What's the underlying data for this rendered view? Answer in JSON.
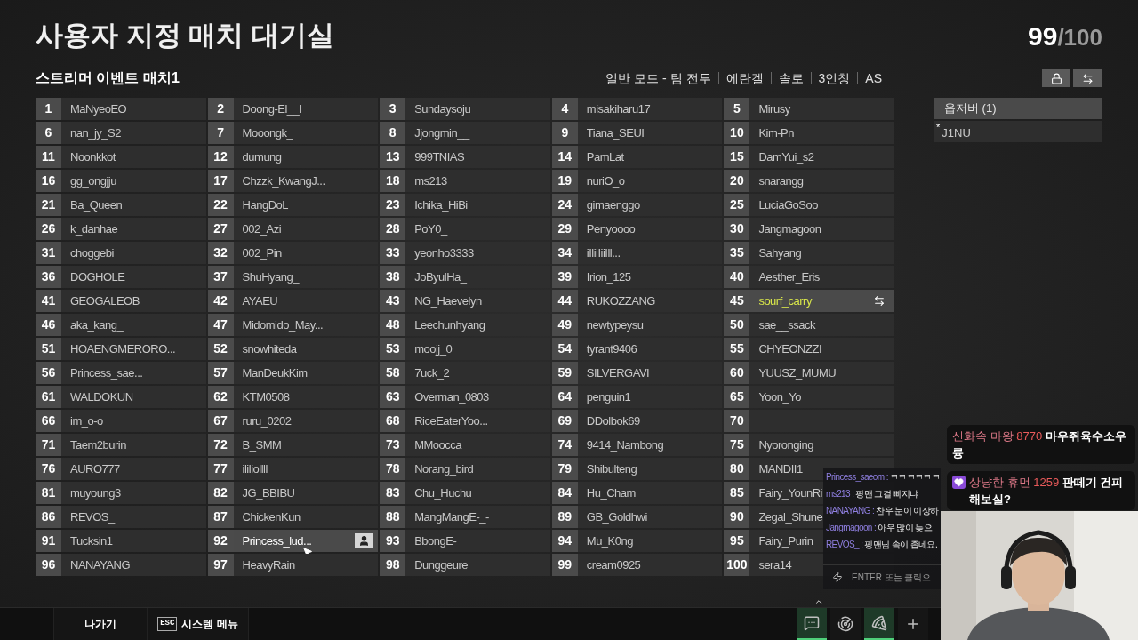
{
  "header": {
    "title": "사용자 지정 매치 대기실",
    "count": "99",
    "capacity": "/100"
  },
  "match": {
    "name": "스트리머 이벤트 매치1",
    "tags": [
      "일반 모드 - 팀 전투",
      "에란겔",
      "솔로",
      "3인칭",
      "AS"
    ]
  },
  "slots": [
    {
      "number": "1",
      "name": "MaNyeoEO",
      "selected": false,
      "hovered": false
    },
    {
      "number": "2",
      "name": "Doong-El__l",
      "selected": false,
      "hovered": false
    },
    {
      "number": "3",
      "name": "Sundaysoju",
      "selected": false,
      "hovered": false
    },
    {
      "number": "4",
      "name": "misakiharu17",
      "selected": false,
      "hovered": false
    },
    {
      "number": "5",
      "name": "Mirusy",
      "selected": false,
      "hovered": false
    },
    {
      "number": "6",
      "name": "nan_jy_S2",
      "selected": false,
      "hovered": false
    },
    {
      "number": "7",
      "name": "Mooongk_",
      "selected": false,
      "hovered": false
    },
    {
      "number": "8",
      "name": "Jjongmin__",
      "selected": false,
      "hovered": false
    },
    {
      "number": "9",
      "name": "Tiana_SEUI",
      "selected": false,
      "hovered": false
    },
    {
      "number": "10",
      "name": "Kim-Pn",
      "selected": false,
      "hovered": false
    },
    {
      "number": "11",
      "name": "Noonkkot",
      "selected": false,
      "hovered": false
    },
    {
      "number": "12",
      "name": "dumung",
      "selected": false,
      "hovered": false
    },
    {
      "number": "13",
      "name": "999TNIAS",
      "selected": false,
      "hovered": false
    },
    {
      "number": "14",
      "name": "PamLat",
      "selected": false,
      "hovered": false
    },
    {
      "number": "15",
      "name": "DamYui_s2",
      "selected": false,
      "hovered": false
    },
    {
      "number": "16",
      "name": "gg_ongjju",
      "selected": false,
      "hovered": false
    },
    {
      "number": "17",
      "name": "Chzzk_KwangJ...",
      "selected": false,
      "hovered": false
    },
    {
      "number": "18",
      "name": "ms213",
      "selected": false,
      "hovered": false
    },
    {
      "number": "19",
      "name": "nuriO_o",
      "selected": false,
      "hovered": false
    },
    {
      "number": "20",
      "name": "snarangg",
      "selected": false,
      "hovered": false
    },
    {
      "number": "21",
      "name": "Ba_Queen",
      "selected": false,
      "hovered": false
    },
    {
      "number": "22",
      "name": "HangDoL",
      "selected": false,
      "hovered": false
    },
    {
      "number": "23",
      "name": "Ichika_HiBi",
      "selected": false,
      "hovered": false
    },
    {
      "number": "24",
      "name": "gimaenggo",
      "selected": false,
      "hovered": false
    },
    {
      "number": "25",
      "name": "LuciaGoSoo",
      "selected": false,
      "hovered": false
    },
    {
      "number": "26",
      "name": "k_danhae",
      "selected": false,
      "hovered": false
    },
    {
      "number": "27",
      "name": "002_Azi",
      "selected": false,
      "hovered": false
    },
    {
      "number": "28",
      "name": "PoY0_",
      "selected": false,
      "hovered": false
    },
    {
      "number": "29",
      "name": "Penyoooo",
      "selected": false,
      "hovered": false
    },
    {
      "number": "30",
      "name": "Jangmagoon",
      "selected": false,
      "hovered": false
    },
    {
      "number": "31",
      "name": "choggebi",
      "selected": false,
      "hovered": false
    },
    {
      "number": "32",
      "name": "002_Pin",
      "selected": false,
      "hovered": false
    },
    {
      "number": "33",
      "name": "yeonho3333",
      "selected": false,
      "hovered": false
    },
    {
      "number": "34",
      "name": "iIliiIiiIll...",
      "selected": false,
      "hovered": false
    },
    {
      "number": "35",
      "name": "Sahyang",
      "selected": false,
      "hovered": false
    },
    {
      "number": "36",
      "name": "DOGHOLE",
      "selected": false,
      "hovered": false
    },
    {
      "number": "37",
      "name": "ShuHyang_",
      "selected": false,
      "hovered": false
    },
    {
      "number": "38",
      "name": "JoByulHa_",
      "selected": false,
      "hovered": false
    },
    {
      "number": "39",
      "name": "Irion_125",
      "selected": false,
      "hovered": false
    },
    {
      "number": "40",
      "name": "Aesther_Eris",
      "selected": false,
      "hovered": false
    },
    {
      "number": "41",
      "name": "GEOGALEOB",
      "selected": false,
      "hovered": false
    },
    {
      "number": "42",
      "name": "AYAEU",
      "selected": false,
      "hovered": false
    },
    {
      "number": "43",
      "name": "NG_Haevelyn",
      "selected": false,
      "hovered": false
    },
    {
      "number": "44",
      "name": "RUKOZZANG",
      "selected": false,
      "hovered": false
    },
    {
      "number": "45",
      "name": "sourf_carry",
      "selected": true,
      "hovered": false
    },
    {
      "number": "46",
      "name": "aka_kang_",
      "selected": false,
      "hovered": false
    },
    {
      "number": "47",
      "name": "Midomido_May...",
      "selected": false,
      "hovered": false
    },
    {
      "number": "48",
      "name": "Leechunhyang",
      "selected": false,
      "hovered": false
    },
    {
      "number": "49",
      "name": "newtypeysu",
      "selected": false,
      "hovered": false
    },
    {
      "number": "50",
      "name": "sae__ssack",
      "selected": false,
      "hovered": false
    },
    {
      "number": "51",
      "name": "HOAENGMERORO...",
      "selected": false,
      "hovered": false
    },
    {
      "number": "52",
      "name": "snowhiteda",
      "selected": false,
      "hovered": false
    },
    {
      "number": "53",
      "name": "moojj_0",
      "selected": false,
      "hovered": false
    },
    {
      "number": "54",
      "name": "tyrant9406",
      "selected": false,
      "hovered": false
    },
    {
      "number": "55",
      "name": "CHYEONZZI",
      "selected": false,
      "hovered": false
    },
    {
      "number": "56",
      "name": "Princess_sae...",
      "selected": false,
      "hovered": false
    },
    {
      "number": "57",
      "name": "ManDeukKim",
      "selected": false,
      "hovered": false
    },
    {
      "number": "58",
      "name": "7uck_2",
      "selected": false,
      "hovered": false
    },
    {
      "number": "59",
      "name": "SILVERGAVI",
      "selected": false,
      "hovered": false
    },
    {
      "number": "60",
      "name": "YUUSZ_MUMU",
      "selected": false,
      "hovered": false
    },
    {
      "number": "61",
      "name": "WALDOKUN",
      "selected": false,
      "hovered": false
    },
    {
      "number": "62",
      "name": "KTM0508",
      "selected": false,
      "hovered": false
    },
    {
      "number": "63",
      "name": "Overman_0803",
      "selected": false,
      "hovered": false
    },
    {
      "number": "64",
      "name": "penguin1",
      "selected": false,
      "hovered": false
    },
    {
      "number": "65",
      "name": "Yoon_Yo",
      "selected": false,
      "hovered": false
    },
    {
      "number": "66",
      "name": "im_o-o",
      "selected": false,
      "hovered": false
    },
    {
      "number": "67",
      "name": "ruru_0202",
      "selected": false,
      "hovered": false
    },
    {
      "number": "68",
      "name": "RiceEaterYoo...",
      "selected": false,
      "hovered": false
    },
    {
      "number": "69",
      "name": "DDolbok69",
      "selected": false,
      "hovered": false
    },
    {
      "number": "70",
      "selected": false,
      "hovered": false
    },
    {
      "number": "71",
      "name": "Taem2burin",
      "selected": false,
      "hovered": false
    },
    {
      "number": "72",
      "name": "B_SMM",
      "selected": false,
      "hovered": false
    },
    {
      "number": "73",
      "name": "MMoocca",
      "selected": false,
      "hovered": false
    },
    {
      "number": "74",
      "name": "9414_Nambong",
      "selected": false,
      "hovered": false
    },
    {
      "number": "75",
      "name": "Nyoronging",
      "selected": false,
      "hovered": false
    },
    {
      "number": "76",
      "name": "AURO777",
      "selected": false,
      "hovered": false
    },
    {
      "number": "77",
      "name": "ililiollll",
      "selected": false,
      "hovered": false
    },
    {
      "number": "78",
      "name": "Norang_bird",
      "selected": false,
      "hovered": false
    },
    {
      "number": "79",
      "name": "Shibulteng",
      "selected": false,
      "hovered": false
    },
    {
      "number": "80",
      "name": "MANDII1",
      "selected": false,
      "hovered": false
    },
    {
      "number": "81",
      "name": "muyoung3",
      "selected": false,
      "hovered": false
    },
    {
      "number": "82",
      "name": "JG_BBIBU",
      "selected": false,
      "hovered": false
    },
    {
      "number": "83",
      "name": "Chu_Huchu",
      "selected": false,
      "hovered": false
    },
    {
      "number": "84",
      "name": "Hu_Cham",
      "selected": false,
      "hovered": false
    },
    {
      "number": "85",
      "name": "Fairy_YounRi",
      "selected": false,
      "hovered": false
    },
    {
      "number": "86",
      "name": "REVOS_",
      "selected": false,
      "hovered": false
    },
    {
      "number": "87",
      "name": "ChickenKun",
      "selected": false,
      "hovered": false
    },
    {
      "number": "88",
      "name": "MangMangE-_-",
      "selected": false,
      "hovered": false
    },
    {
      "number": "89",
      "name": "GB_Goldhwi",
      "selected": false,
      "hovered": false
    },
    {
      "number": "90",
      "name": "Zegal_Shune",
      "selected": false,
      "hovered": false
    },
    {
      "number": "91",
      "name": "Tucksin1",
      "selected": false,
      "hovered": false
    },
    {
      "number": "92",
      "name": "Princess_lud...",
      "selected": false,
      "hovered": true
    },
    {
      "number": "93",
      "name": "BbongE-",
      "selected": false,
      "hovered": false
    },
    {
      "number": "94",
      "name": "Mu_K0ng",
      "selected": false,
      "hovered": false
    },
    {
      "number": "95",
      "name": "Fairy_Purin",
      "selected": false,
      "hovered": false
    },
    {
      "number": "96",
      "name": "NANAYANG",
      "selected": false,
      "hovered": false
    },
    {
      "number": "97",
      "name": "HeavyRain",
      "selected": false,
      "hovered": false
    },
    {
      "number": "98",
      "name": "Dunggeure",
      "selected": false,
      "hovered": false
    },
    {
      "number": "99",
      "name": "cream0925",
      "selected": false,
      "hovered": false
    },
    {
      "number": "100",
      "name": "sera14",
      "selected": false,
      "hovered": false
    }
  ],
  "observers": {
    "title": "옵저버 (1)",
    "players": [
      {
        "mark": "*",
        "name": "J1NU"
      }
    ]
  },
  "chat": {
    "messages": [
      {
        "user": "Princess_saeom :",
        "text": "ㅋㅋㅋㅋㅋㅋ"
      },
      {
        "user": "ms213 :",
        "text": "핑맨 그걸 삐지냐"
      },
      {
        "user": "NANAYANG :",
        "text": "찬우 눈이 이상하"
      },
      {
        "user": "Jangmagoon :",
        "text": "아우 많이 늦으"
      },
      {
        "user": "REVOS_ :",
        "text": "핑맨님 속이 좁네요."
      }
    ],
    "placeholder": "ENTER 또는 클릭으"
  },
  "donations": [
    {
      "donor": "신화속 마왕",
      "amount": "8770",
      "message": "마우쥐육수소우륭",
      "heart": false
    },
    {
      "donor": "상냥한 휴먼",
      "amount": "1259",
      "message": "판떼기 건피해보실?",
      "heart": true
    }
  ],
  "bottom_bar": {
    "exit": "나가기",
    "menu_key": "ESC",
    "menu": "시스템 메뉴",
    "tools": [
      {
        "kind": "chat",
        "selected": true
      },
      {
        "kind": "radar",
        "selected": false
      },
      {
        "kind": "pizza",
        "selected": true
      },
      {
        "kind": "add",
        "selected": false
      }
    ]
  }
}
